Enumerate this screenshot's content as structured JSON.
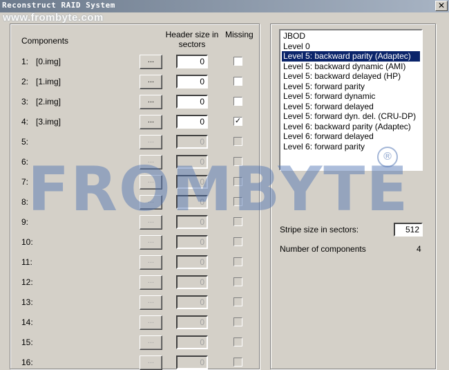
{
  "window": {
    "title": "Reconstruct RAID System",
    "watermark_url": "www.frombyte.com"
  },
  "left_panel": {
    "col_components": "Components",
    "col_header_size": "Header size in sectors",
    "col_missing": "Missing",
    "browse_label": "...",
    "rows": [
      {
        "num": "1:",
        "file": "[0.img]",
        "header": "0",
        "missing": false,
        "enabled": true
      },
      {
        "num": "2:",
        "file": "[1.img]",
        "header": "0",
        "missing": false,
        "enabled": true
      },
      {
        "num": "3:",
        "file": "[2.img]",
        "header": "0",
        "missing": false,
        "enabled": true
      },
      {
        "num": "4:",
        "file": "[3.img]",
        "header": "0",
        "missing": true,
        "enabled": true
      },
      {
        "num": "5:",
        "file": "",
        "header": "0",
        "missing": false,
        "enabled": false
      },
      {
        "num": "6:",
        "file": "",
        "header": "0",
        "missing": false,
        "enabled": false
      },
      {
        "num": "7:",
        "file": "",
        "header": "0",
        "missing": false,
        "enabled": false
      },
      {
        "num": "8:",
        "file": "",
        "header": "0",
        "missing": false,
        "enabled": false
      },
      {
        "num": "9:",
        "file": "",
        "header": "0",
        "missing": false,
        "enabled": false
      },
      {
        "num": "10:",
        "file": "",
        "header": "0",
        "missing": false,
        "enabled": false
      },
      {
        "num": "11:",
        "file": "",
        "header": "0",
        "missing": false,
        "enabled": false
      },
      {
        "num": "12:",
        "file": "",
        "header": "0",
        "missing": false,
        "enabled": false
      },
      {
        "num": "13:",
        "file": "",
        "header": "0",
        "missing": false,
        "enabled": false
      },
      {
        "num": "14:",
        "file": "",
        "header": "0",
        "missing": false,
        "enabled": false
      },
      {
        "num": "15:",
        "file": "",
        "header": "0",
        "missing": false,
        "enabled": false
      },
      {
        "num": "16:",
        "file": "",
        "header": "0",
        "missing": false,
        "enabled": false
      }
    ]
  },
  "right_panel": {
    "raid_levels": [
      "JBOD",
      "Level 0",
      "Level 5: backward parity (Adaptec)",
      "Level 5: backward dynamic (AMI)",
      "Level 5: backward delayed (HP)",
      "Level 5: forward parity",
      "Level 5: forward dynamic",
      "Level 5: forward delayed",
      "Level 5: forward dyn. del. (CRU-DP)",
      "Level 6: backward parity (Adaptec)",
      "Level 6: forward delayed",
      "Level 6: forward parity"
    ],
    "selected_index": 2,
    "stripe_label": "Stripe size in sectors:",
    "stripe_value": "512",
    "num_components_label": "Number of components",
    "num_components_value": "4"
  },
  "branding": {
    "watermark_text": "FROMBYTE",
    "registered_mark": "®"
  },
  "colors": {
    "selection": "#0a246a",
    "face": "#d4d0c8"
  }
}
